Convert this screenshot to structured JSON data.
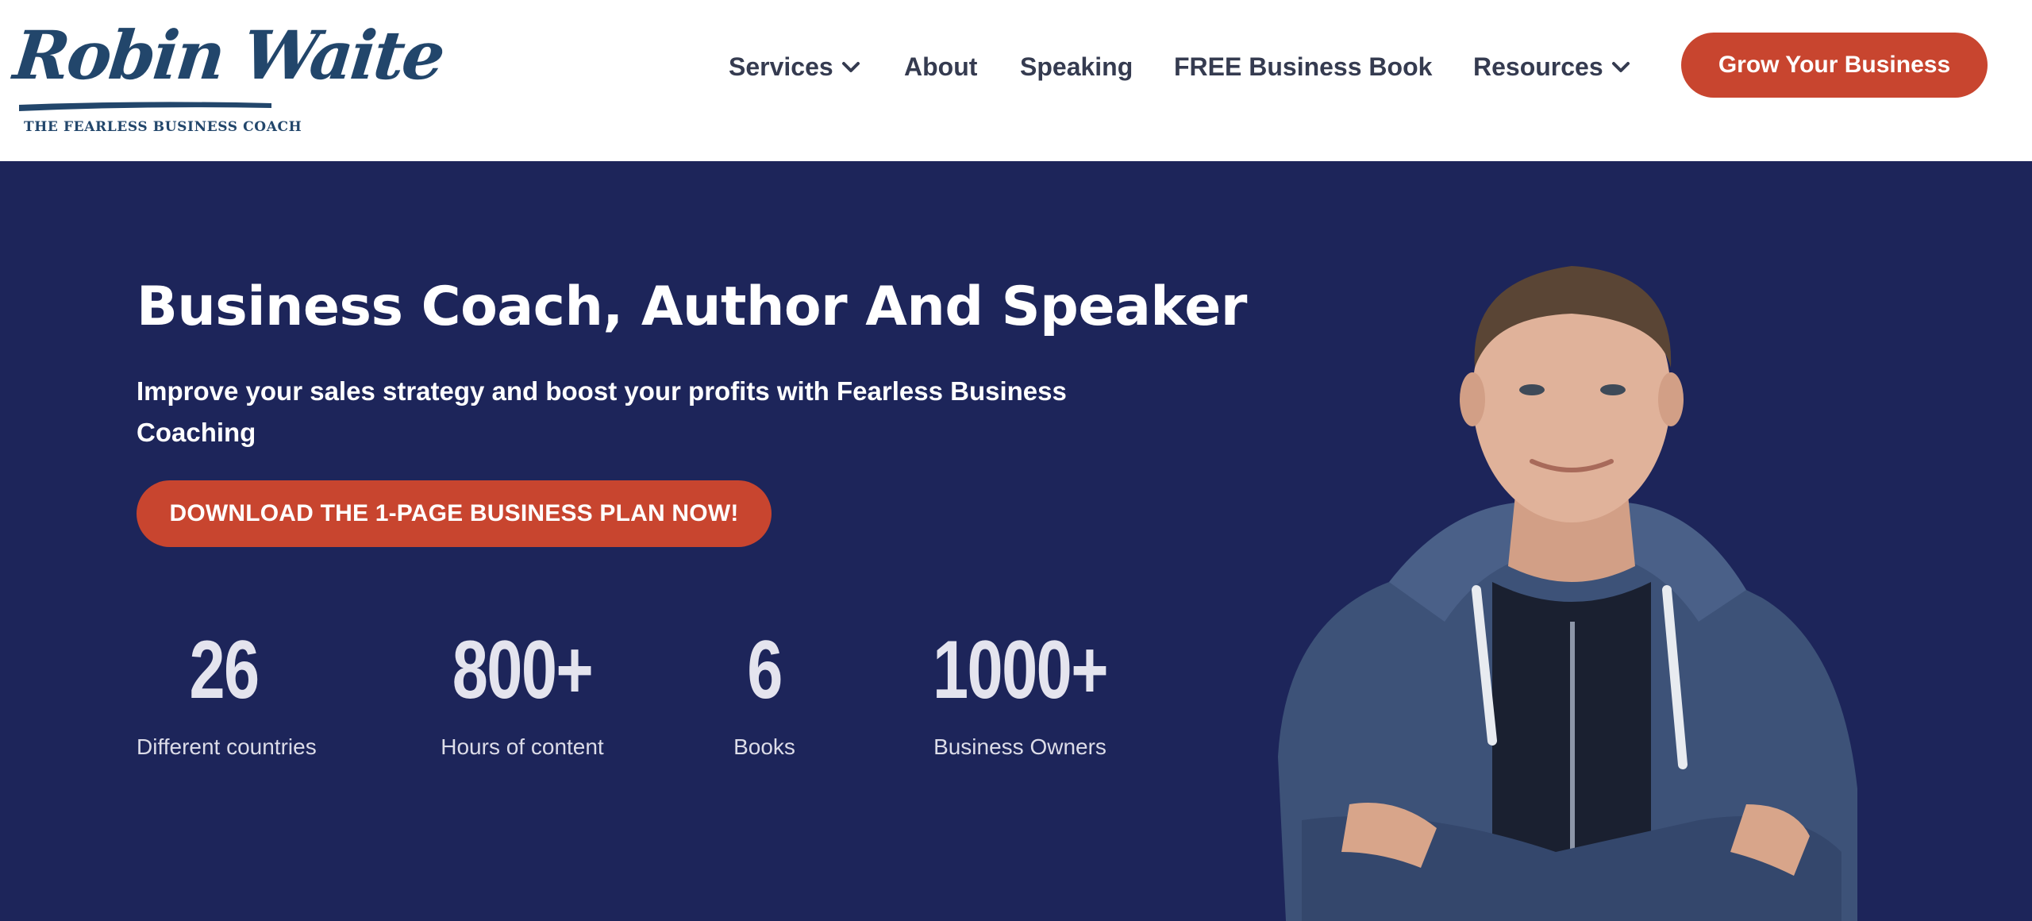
{
  "header": {
    "logo": {
      "name": "Robin Waite",
      "tagline": "THE FEARLESS BUSINESS COACH",
      "icon": "robin-waite-logo",
      "color": "#22466b"
    },
    "nav": [
      {
        "label": "Services",
        "has_dropdown": true
      },
      {
        "label": "About",
        "has_dropdown": false
      },
      {
        "label": "Speaking",
        "has_dropdown": false
      },
      {
        "label": "FREE Business Book",
        "has_dropdown": false
      },
      {
        "label": "Resources",
        "has_dropdown": true
      }
    ],
    "cta_label": "Grow Your Business"
  },
  "hero": {
    "title": "Business Coach, Author And Speaker",
    "subtitle": "Improve your sales strategy and boost your profits with Fearless Business Coaching",
    "cta_label": "DOWNLOAD THE 1-PAGE BUSINESS PLAN NOW!",
    "stats": [
      {
        "value": "26",
        "label": "Different countries"
      },
      {
        "value": "800+",
        "label": "Hours of content"
      },
      {
        "value": "6",
        "label": "Books"
      },
      {
        "value": "1000+",
        "label": "Business Owners"
      }
    ],
    "image": "portrait-photo"
  },
  "colors": {
    "accent": "#c8452f",
    "hero_background": "#1d255a",
    "nav_text": "#353b50",
    "stat_number": "#e4e4ee"
  }
}
